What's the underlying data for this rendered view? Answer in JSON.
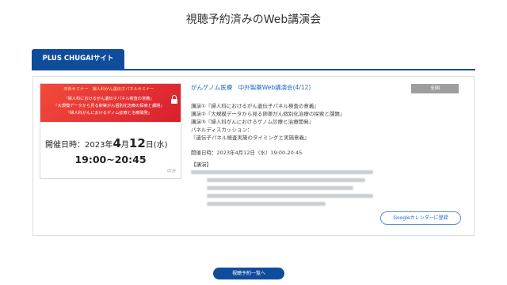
{
  "page": {
    "title": "視聴予約済みのWeb講演会"
  },
  "tabs": [
    {
      "label": "PLUS CHUGAIサイト",
      "active": true
    }
  ],
  "event": {
    "thumbnail": {
      "banner_title": "中外セミナー　婦人科がん遺伝子パネルセミナー",
      "banner_lines": [
        "『婦人科におけるがん遺伝子パネル検査の意義』",
        "『大規模データから見る卵巣がん個別化治療の探索と課題』",
        "『婦人科がんにおけるゲノム診療と治療開発』"
      ],
      "date_prefix": "開催日時：2023年",
      "month": "4",
      "month_unit": "月",
      "day": "12",
      "day_unit": "日",
      "weekday": "(水)",
      "time": "19:00~20:45",
      "logo": "中外"
    },
    "title": "がんゲノム医療　中外製薬Web講演会(4/12)",
    "badge": "全国",
    "lectures": [
      "講演①『婦人科におけるがん遺伝子パネル検査の意義』",
      "講演②『大規模データから見る卵巣がん個別化治療の探索と課題』",
      "講演③『婦人科がんにおけるゲノム診療と治療開発』",
      "パネルディスカッション：",
      "『遺伝子パネル検査実施のタイミングと実施意義』"
    ],
    "datetime": "開催日時：2023年4月12日（水）19:00-20:45",
    "lecture_section_label": "【講演】",
    "google_calendar_label": "Googleカレンダーに登録"
  },
  "footer": {
    "list_button_label": "視聴予約一覧へ"
  },
  "colors": {
    "primary": "#0f4c9c",
    "link": "#1a66c2",
    "badge_bg": "#9e9e9e",
    "banner_red": "#e2312f"
  }
}
